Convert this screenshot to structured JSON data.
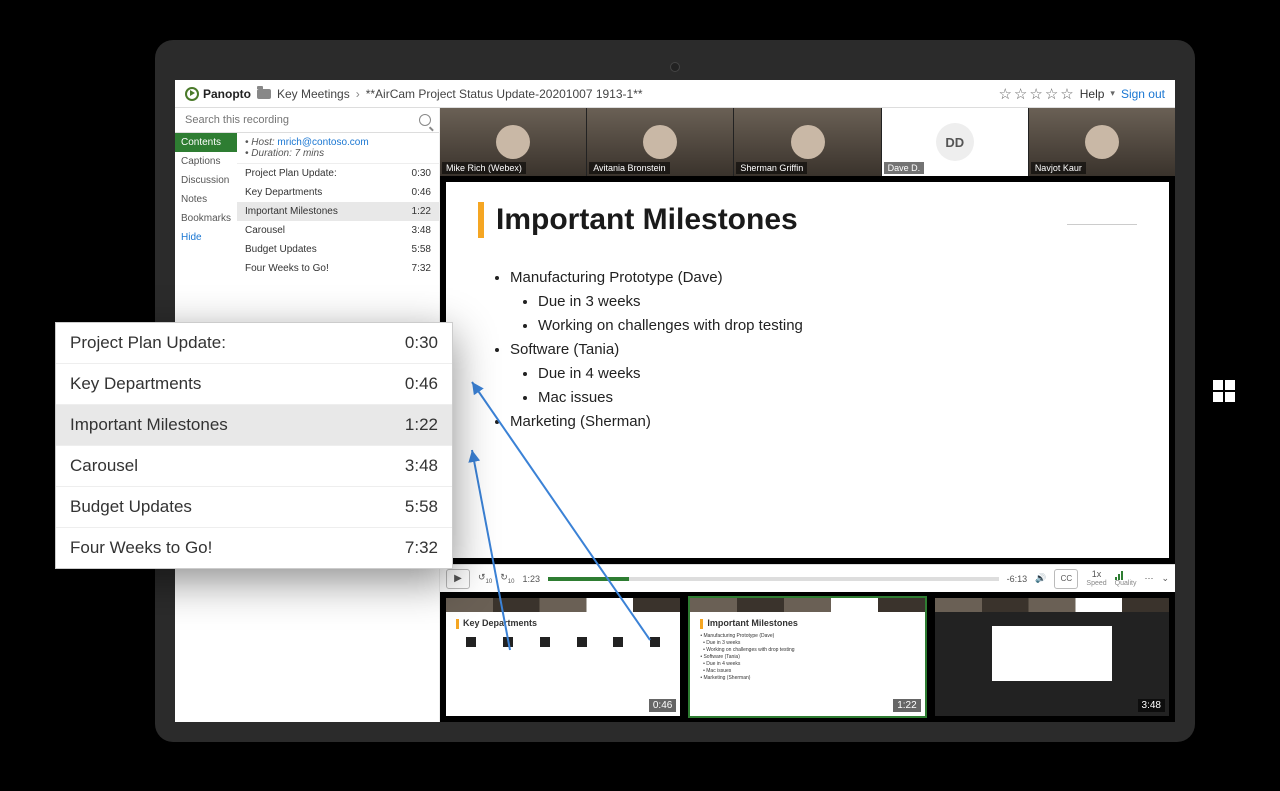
{
  "app": {
    "brand": "Panopto",
    "help_label": "Help",
    "signout_label": "Sign out"
  },
  "breadcrumb": {
    "folder": "Key Meetings",
    "title": "**AirCam Project Status Update-20201007 1913-1**"
  },
  "rating": {
    "value": 0,
    "max": 5
  },
  "search": {
    "placeholder": "Search this recording"
  },
  "side_tabs": [
    "Contents",
    "Captions",
    "Discussion",
    "Notes",
    "Bookmarks",
    "Hide"
  ],
  "active_tab": "Contents",
  "meta": {
    "host_label": "Host:",
    "host_email": "mrich@contoso.com",
    "duration_label": "Duration: 7 mins"
  },
  "toc": [
    {
      "label": "Project Plan Update:",
      "time": "0:30"
    },
    {
      "label": "Key Departments",
      "time": "0:46"
    },
    {
      "label": "Important Milestones",
      "time": "1:22",
      "selected": true
    },
    {
      "label": "Carousel",
      "time": "3:48"
    },
    {
      "label": "Budget Updates",
      "time": "5:58"
    },
    {
      "label": "Four Weeks to Go!",
      "time": "7:32"
    }
  ],
  "participants": [
    {
      "name": "Mike Rich (Webex)"
    },
    {
      "name": "Avitania Bronstein"
    },
    {
      "name": "Sherman Griffin"
    },
    {
      "name": "Dave D.",
      "initials": "DD"
    },
    {
      "name": "Navjot Kaur"
    }
  ],
  "slide": {
    "title": "Important Milestones",
    "bullets": [
      {
        "text": "Manufacturing Prototype (Dave)",
        "sub": [
          "Due in 3 weeks",
          "Working on challenges with drop testing"
        ]
      },
      {
        "text": "Software (Tania)",
        "sub": [
          "Due in 4 weeks",
          "Mac issues"
        ]
      },
      {
        "text": "Marketing (Sherman)",
        "sub": []
      }
    ]
  },
  "player": {
    "current": "1:23",
    "remaining": "-6:13",
    "speed": "1x",
    "speed_label": "Speed",
    "quality_label": "Quality",
    "cc_label": "CC",
    "skip_back": "10",
    "skip_fwd": "10"
  },
  "thumbnails": [
    {
      "title": "Key Departments",
      "time": "0:46",
      "type": "icons"
    },
    {
      "title": "Important Milestones",
      "time": "1:22",
      "type": "text",
      "active": true
    },
    {
      "title": "",
      "time": "3:48",
      "type": "dark"
    }
  ]
}
